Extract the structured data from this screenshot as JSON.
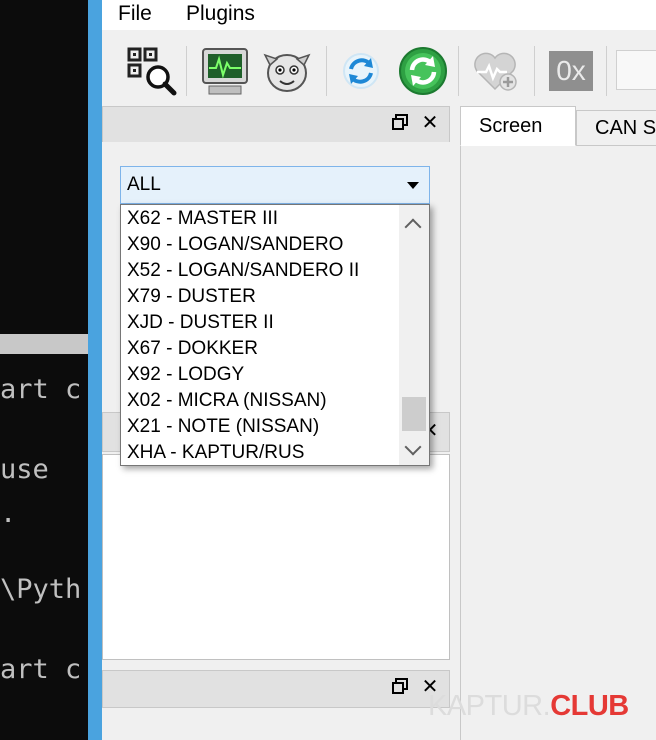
{
  "terminal": {
    "lines": [
      "art c",
      "use",
      ".",
      "\\Pyth",
      "art c"
    ]
  },
  "menu": {
    "file": "File",
    "plugins": "Plugins"
  },
  "toolbar": {
    "hex_label": "0x"
  },
  "ecu_panel": {
    "combo_value": "ALL",
    "dropdown_items": [
      "X62 - MASTER III",
      "X90 - LOGAN/SANDERO",
      "X52 - LOGAN/SANDERO II",
      "X79 - DUSTER",
      "XJD - DUSTER II",
      "X67 - DOKKER",
      "X92 - LODGY",
      "X02 - MICRA (NISSAN)",
      "X21 - NOTE (NISSAN)",
      "XHA - KAPTUR/RUS"
    ]
  },
  "dock": {
    "float_icon": "restore-icon",
    "close_glyph": "✕"
  },
  "tabs": {
    "screen": "Screen",
    "can": "CAN S"
  },
  "watermark": {
    "part1": "KAPTUR.",
    "part2": "CLUB"
  },
  "colors": {
    "accent": "#4aa3df",
    "combo_bg": "#e5f1fb",
    "combo_border": "#7eb4ea",
    "watermark_red": "#e53935"
  }
}
